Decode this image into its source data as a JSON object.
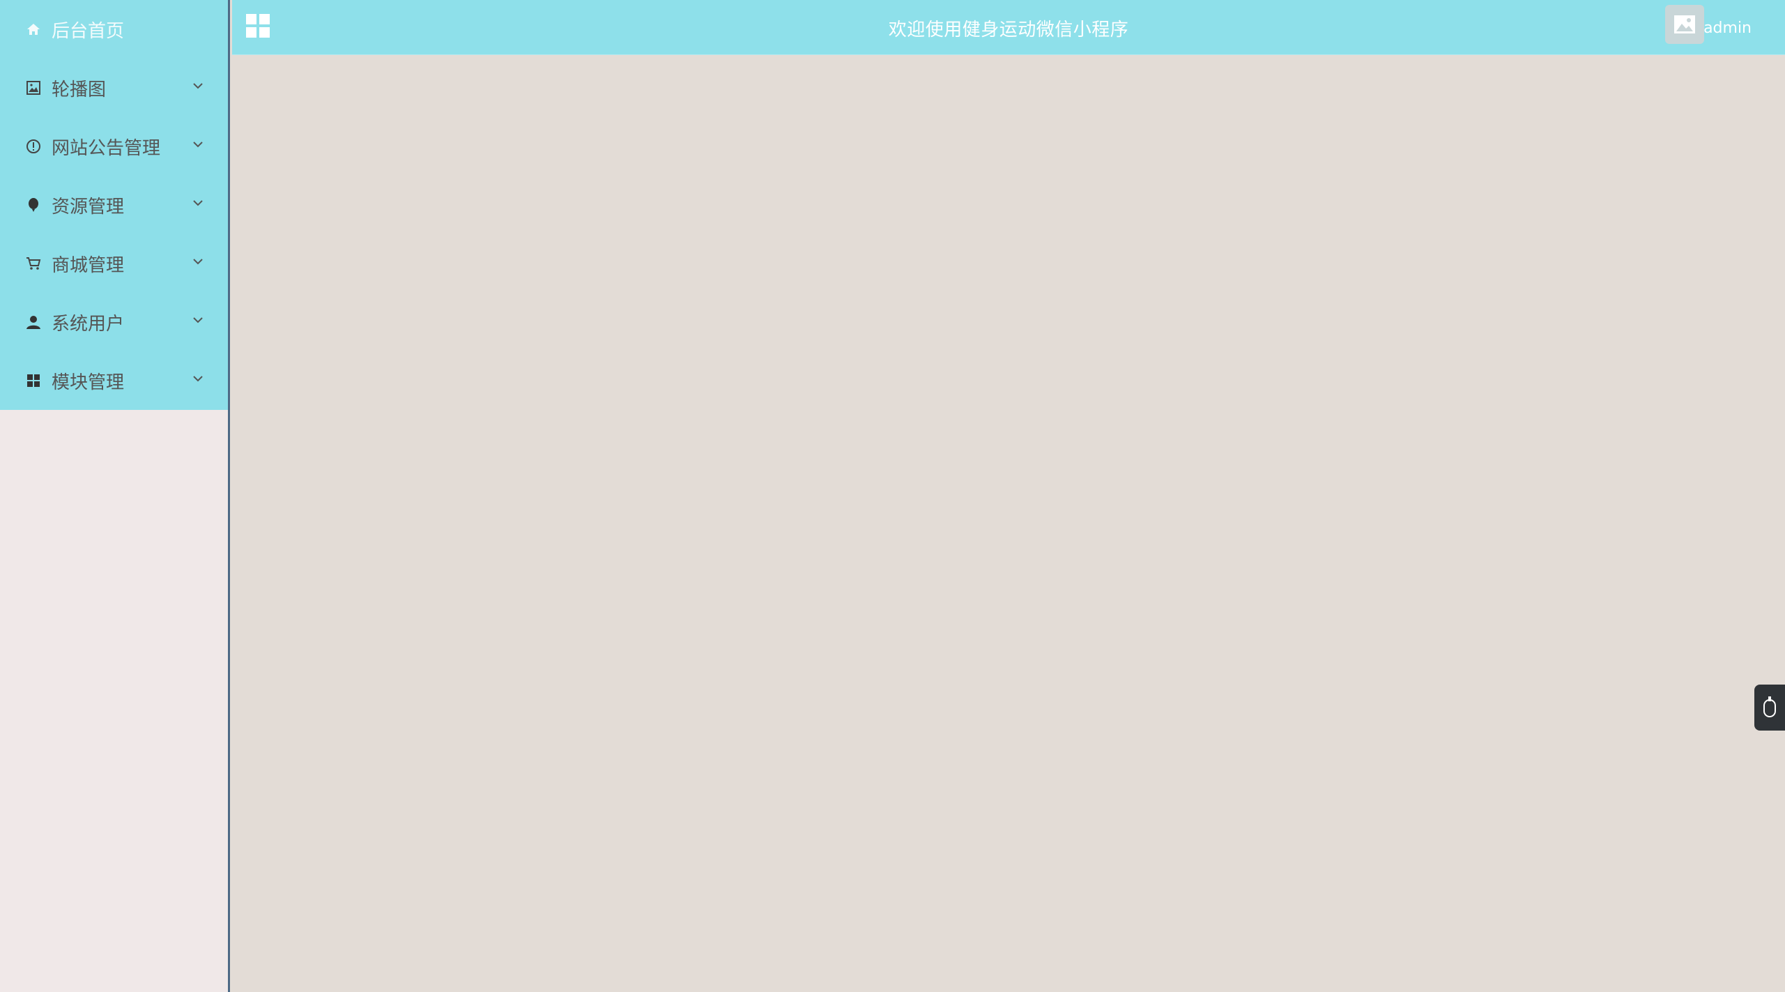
{
  "header": {
    "title": "欢迎使用健身运动微信小程序",
    "username": "admin"
  },
  "sidebar": {
    "items": [
      {
        "label": "后台首页",
        "icon": "home-icon"
      },
      {
        "label": "轮播图",
        "icon": "image-icon"
      },
      {
        "label": "网站公告管理",
        "icon": "info-circle-icon"
      },
      {
        "label": "资源管理",
        "icon": "balloon-icon"
      },
      {
        "label": "商城管理",
        "icon": "cart-icon"
      },
      {
        "label": "系统用户",
        "icon": "user-icon"
      },
      {
        "label": "模块管理",
        "icon": "grid-icon"
      }
    ]
  },
  "colors": {
    "sidebar_menu_bg": "#8ddfe9",
    "header_bg": "#8ee0ea",
    "content_bg": "#e3dcd6",
    "sidebar_bg": "#f0e8e8"
  }
}
